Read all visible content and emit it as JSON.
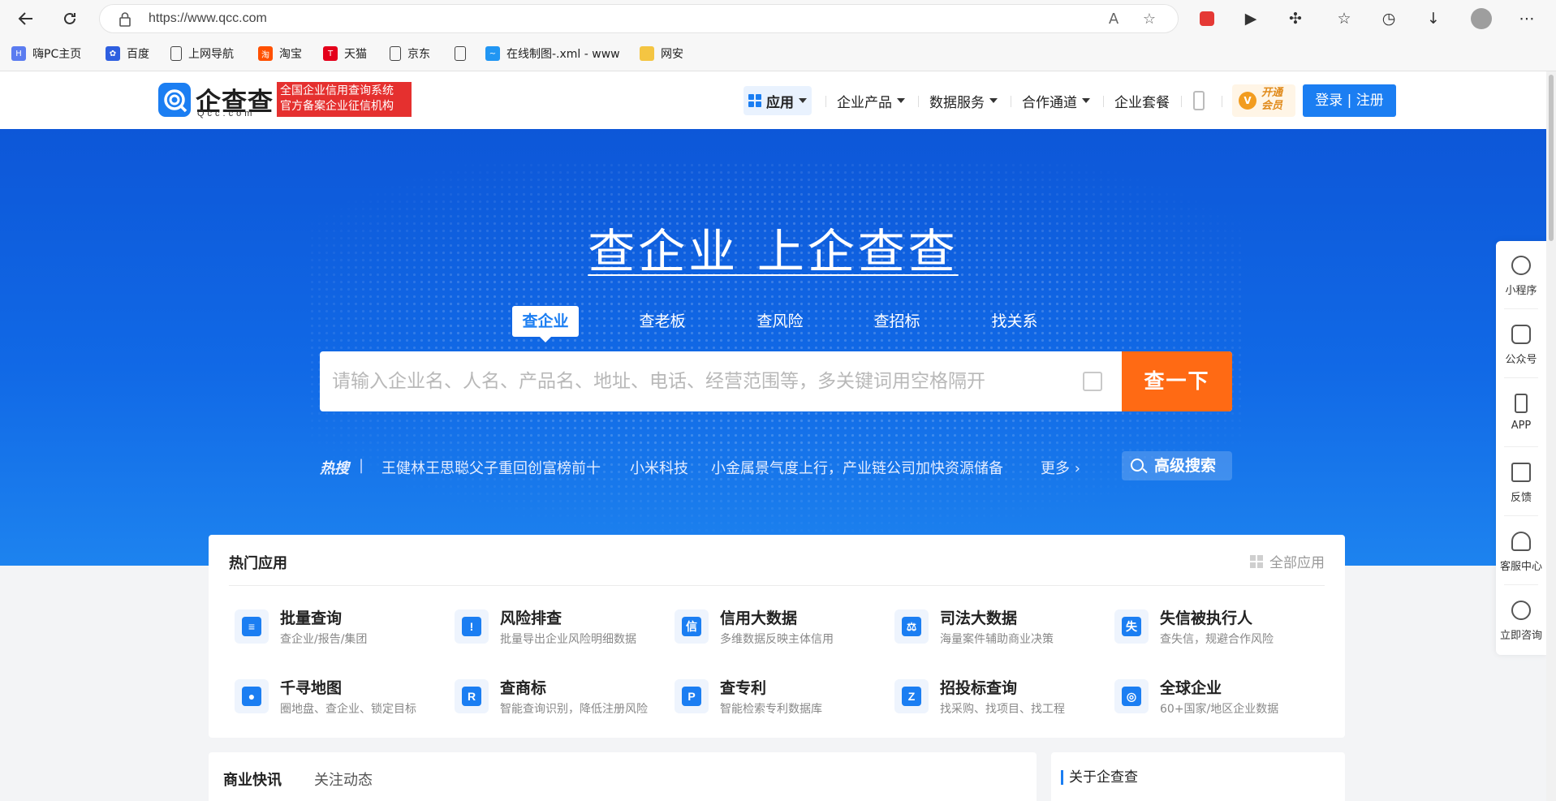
{
  "browser": {
    "url": "https://www.qcc.com",
    "back_icon": "back-arrow-icon",
    "reload_icon": "reload-icon",
    "bookmarks": [
      {
        "label": "嗨PC主页",
        "icon": "hipc-icon",
        "color": "#5b7cf0"
      },
      {
        "label": "百度",
        "icon": "baidu-paw-icon",
        "color": "#2e5fe0"
      },
      {
        "label": "上网导航",
        "icon": "page-icon",
        "color": "#ffffff"
      },
      {
        "label": "淘宝",
        "icon": "taobao-icon",
        "color": "#ff5000"
      },
      {
        "label": "天猫",
        "icon": "tmall-icon",
        "color": "#e4001b"
      },
      {
        "label": "京东",
        "icon": "page-icon",
        "color": "#ffffff"
      },
      {
        "label": "",
        "icon": "page-icon",
        "color": "#ffffff"
      },
      {
        "label": "在线制图-.xml - www",
        "icon": "drawio-icon",
        "color": "#2196f3"
      },
      {
        "label": "网安",
        "icon": "folder-icon",
        "color": "#f4c542"
      }
    ]
  },
  "header": {
    "logo_text": "企查查",
    "logo_domain": "Qcc.com",
    "logo_tag_line1": "全国企业信用查询系统",
    "logo_tag_line2": "官方备案企业征信机构",
    "nav": {
      "app": "应用",
      "products": "企业产品",
      "data": "数据服务",
      "partner": "合作通道",
      "package": "企业套餐"
    },
    "vip_line1": "开通",
    "vip_line2": "会员",
    "login": "登录 | 注册"
  },
  "hero": {
    "title": "查企业  上企查查",
    "tabs": [
      "查企业",
      "查老板",
      "查风险",
      "查招标",
      "找关系"
    ],
    "active_tab": "查企业",
    "search_placeholder": "请输入企业名、人名、产品名、地址、电话、经营范围等，多关键词用空格隔开",
    "search_button": "查一下",
    "hot_label": "热搜",
    "hot_items": [
      "王健林王思聪父子重回创富榜前十",
      "小米科技",
      "小金属景气度上行，产业链公司加快资源储备"
    ],
    "more": "更多",
    "advanced": "高级搜索"
  },
  "hot_apps": {
    "title": "热门应用",
    "all_apps": "全部应用",
    "apps": [
      {
        "name": "批量查询",
        "desc": "查企业/报告/集团",
        "icon": "batch-search-icon",
        "glyph": "≡"
      },
      {
        "name": "风险排查",
        "desc": "批量导出企业风险明细数据",
        "icon": "risk-warning-icon",
        "glyph": "!"
      },
      {
        "name": "信用大数据",
        "desc": "多维数据反映主体信用",
        "icon": "credit-icon",
        "glyph": "信"
      },
      {
        "name": "司法大数据",
        "desc": "海量案件辅助商业决策",
        "icon": "justice-scale-icon",
        "glyph": "⚖"
      },
      {
        "name": "失信被执行人",
        "desc": "查失信，规避合作风险",
        "icon": "dishonest-icon",
        "glyph": "失"
      },
      {
        "name": "千寻地图",
        "desc": "圈地盘、查企业、锁定目标",
        "icon": "map-pin-icon",
        "glyph": "●"
      },
      {
        "name": "查商标",
        "desc": "智能查询识别，降低注册风险",
        "icon": "trademark-icon",
        "glyph": "R"
      },
      {
        "name": "查专利",
        "desc": "智能检索专利数据库",
        "icon": "patent-icon",
        "glyph": "P"
      },
      {
        "name": "招投标查询",
        "desc": "找采购、找项目、找工程",
        "icon": "bidding-icon",
        "glyph": "Z"
      },
      {
        "name": "全球企业",
        "desc": "60+国家/地区企业数据",
        "icon": "globe-icon",
        "glyph": "◎"
      }
    ]
  },
  "news": {
    "tab1": "商业快讯",
    "tab2": "关注动态"
  },
  "about": {
    "title": "关于企查查"
  },
  "float_bar": [
    {
      "label": "小程序",
      "icon": "mini-program-icon"
    },
    {
      "label": "公众号",
      "icon": "official-account-icon"
    },
    {
      "label": "APP",
      "icon": "phone-app-icon"
    },
    {
      "label": "反馈",
      "icon": "feedback-icon"
    },
    {
      "label": "客服中心",
      "icon": "headset-icon"
    },
    {
      "label": "立即咨询",
      "icon": "chat-icon"
    }
  ],
  "colors": {
    "brand_blue": "#1b7ef2",
    "search_orange": "#ff6a14",
    "tag_red": "#e5302f"
  }
}
